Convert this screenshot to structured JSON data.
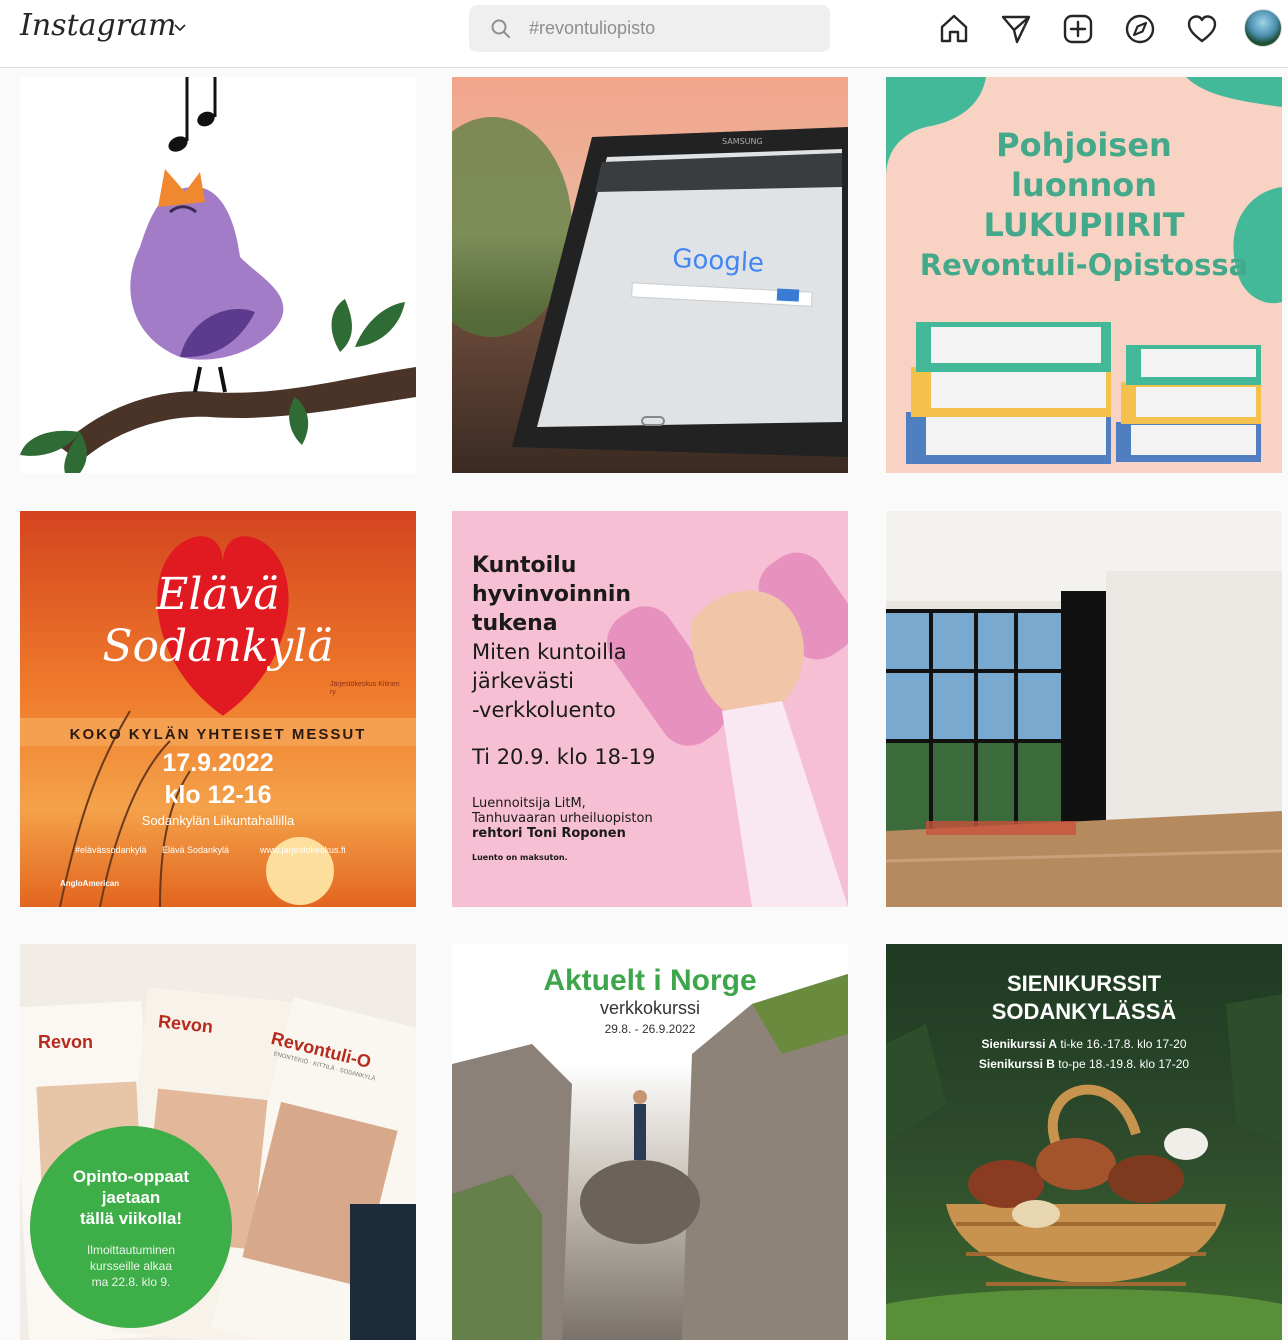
{
  "header": {
    "brand": "Instagram",
    "search": {
      "value": "#revontuliopisto"
    },
    "nav": [
      {
        "name": "home-icon"
      },
      {
        "name": "direct-message-icon"
      },
      {
        "name": "new-post-icon"
      },
      {
        "name": "explore-icon"
      },
      {
        "name": "activity-heart-icon"
      },
      {
        "name": "profile-avatar"
      }
    ]
  },
  "posts": {
    "p1": {
      "icon": "singing-bird-illustration"
    },
    "p2": {
      "brand": "SAMSUNG",
      "logo": "Google"
    },
    "p3": {
      "line1": "Pohjoisen",
      "line2": "luonnon",
      "line3": "LUKUPIIRIT",
      "line4": "Revontuli-Opistossa"
    },
    "p4": {
      "line1": "Elävä",
      "line2": "Sodankylä",
      "headline": "KOKO KYLÄN YHTEISET MESSUT",
      "date": "17.9.2022",
      "time": "klo 12-16",
      "venue": "Sodankylän Liikuntahallilla",
      "hashtag": "#elävässodankylä",
      "page": "Elävä Sodankylä",
      "web": "www.jarjestokeskus.fi",
      "org": "Järjestökeskus Kitinen ry",
      "sponsor": "AngloAmerican"
    },
    "p5": {
      "title1": "Kuntoilu",
      "title2": "hyvinvoinnin",
      "title3": "tukena",
      "sub1": "Miten kuntoilla",
      "sub2": "järkevästi",
      "sub3": "-verkkoluento",
      "when": "Ti 20.9. klo 18-19",
      "lecturer1": "Luennoitsija LitM,",
      "lecturer2": "Tanhuvaaran urheiluopiston",
      "lecturer3": "rehtori Toni Roponen",
      "note": "Luento on maksuton."
    },
    "p6": {
      "icon": "gym-hall-photo"
    },
    "p7": {
      "brand1": "Revon",
      "brand2": "Revon",
      "brand3": "Revontuli-O",
      "subtitle": "ENONTEKIÖ · KITTILÄ · SODANKYLÄ",
      "badge1": "Opinto-oppaat",
      "badge2": "jaetaan",
      "badge3": "tällä viikolla!",
      "info1": "Ilmoittautuminen",
      "info2": "kursseille alkaa",
      "info3": "ma 22.8. klo 9."
    },
    "p8": {
      "title": "Aktuelt i Norge",
      "subtitle": "verkkokurssi",
      "dates": "29.8. - 26.9.2022"
    },
    "p9": {
      "title1": "SIENIKURSSIT",
      "title2": "SODANKYLÄSSÄ",
      "a_label": "Sienikurssi A",
      "a_when": "ti-ke 16.-17.8. klo 17-20",
      "b_label": "Sienikurssi B",
      "b_when": "to-pe 18.-19.8. klo 17-20"
    }
  },
  "colors": {
    "accent_green": "#43b99a",
    "peach": "#f8d3c4",
    "ig_text": "#262626"
  }
}
